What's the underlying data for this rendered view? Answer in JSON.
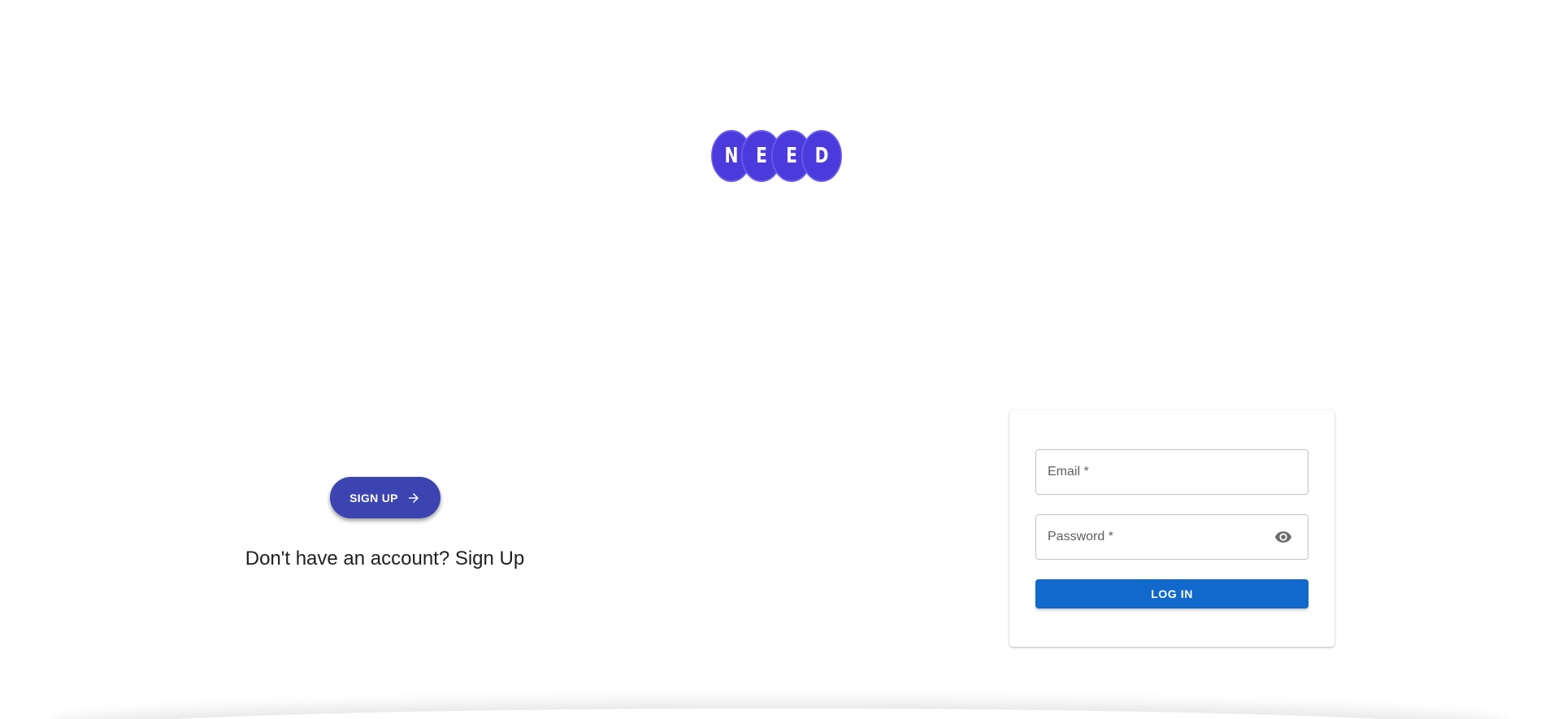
{
  "logo": {
    "letters": [
      "N",
      "E",
      "E",
      "D"
    ],
    "color": "#4b3bdc"
  },
  "signup": {
    "button_label": "SIGN UP",
    "button_icon": "arrow-right-icon",
    "prompt": "Don't have an account? Sign Up",
    "button_color": "#3b44b0"
  },
  "login": {
    "email_label": "Email *",
    "password_label": "Password *",
    "password_icon": "eye-icon",
    "button_label": "LOG IN",
    "button_color": "#1169cb"
  }
}
